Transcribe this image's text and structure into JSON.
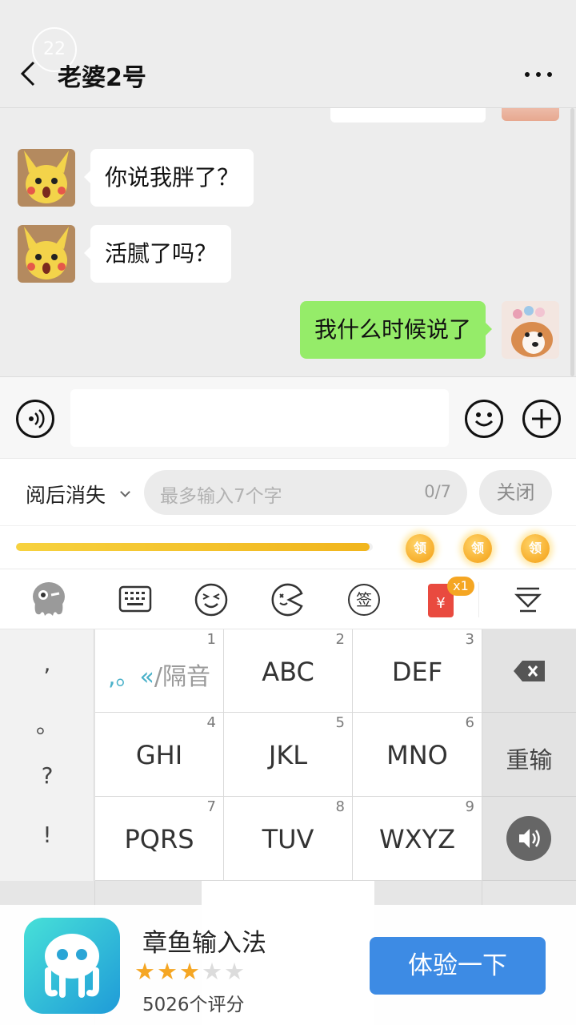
{
  "header": {
    "badge": "22",
    "title": "老婆2号",
    "more_label": "more"
  },
  "chat": {
    "messages": [
      {
        "side": "left",
        "text": "你说我胖了？"
      },
      {
        "side": "left",
        "text": "活腻了吗？"
      },
      {
        "side": "right",
        "text": "我什么时候说了"
      }
    ]
  },
  "burn": {
    "label": "阅后消失",
    "placeholder": "最多输入7个字",
    "count": "0/7",
    "close": "关闭"
  },
  "progress": {
    "fraction": 0.99,
    "coin_label": "领"
  },
  "toolbar": {
    "sign_label": "签",
    "red_packet_badge": "x1"
  },
  "keyboard": {
    "punct": [
      ",",
      "。",
      "?",
      "!"
    ],
    "keys": [
      {
        "num": "1",
        "label": ",。«/隔音"
      },
      {
        "num": "2",
        "label": "ABC"
      },
      {
        "num": "3",
        "label": "DEF"
      },
      {
        "num": "4",
        "label": "GHI"
      },
      {
        "num": "5",
        "label": "JKL"
      },
      {
        "num": "6",
        "label": "MNO"
      },
      {
        "num": "7",
        "label": "PQRS"
      },
      {
        "num": "8",
        "label": "TUV"
      },
      {
        "num": "9",
        "label": "WXYZ"
      }
    ],
    "reinput": "重输"
  },
  "ad": {
    "app_name": "章鱼输入法",
    "stars_filled": 3,
    "stars_total": 5,
    "rating_text": "5026个评分",
    "cta": "体验一下"
  },
  "colors": {
    "sent_bubble": "#95ec69",
    "cta": "#3d8be4",
    "progress": "#f1b51d"
  }
}
